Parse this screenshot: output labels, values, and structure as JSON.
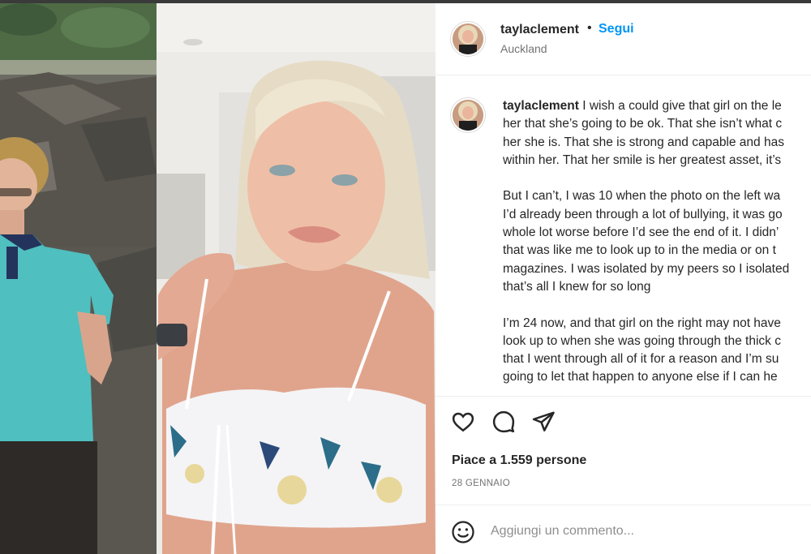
{
  "post": {
    "username": "taylaclement",
    "separator": "•",
    "follow_label": "Segui",
    "location": "Auckland",
    "caption_lines": [
      "I wish a could give that girl on the le",
      "her that she’s going to be ok. That she isn’t what c",
      "her she is. That she is strong and capable and has",
      "within her. That her smile is her greatest asset, it’s",
      "But I can’t, I was 10 when the photo on the left wa",
      "I’d already been through a lot of bullying, it was go",
      "whole lot worse before I’d see the end of it. I didn’",
      "that was like me to look up to in the media or on t",
      "magazines. I was isolated by my peers so I isolated",
      "that’s all I knew for so long",
      "I’m 24 now, and that girl on the right may not have",
      "look up to when she was going through the thick c",
      "that I went through all of it for a reason and I’m su",
      "going to let that happen to anyone else if I can he"
    ],
    "likes_text": "Piace a 1.559 persone",
    "date": "28 GENNAIO",
    "comment_placeholder": "Aggiungi un commento...",
    "icons": {
      "like": "heart-icon",
      "comment": "comment-bubble-icon",
      "share": "paper-plane-icon",
      "emoji": "smiley-icon"
    }
  },
  "colors": {
    "link_blue": "#0095f6",
    "text": "#262626",
    "secondary": "#737373",
    "divider": "#efefef"
  }
}
